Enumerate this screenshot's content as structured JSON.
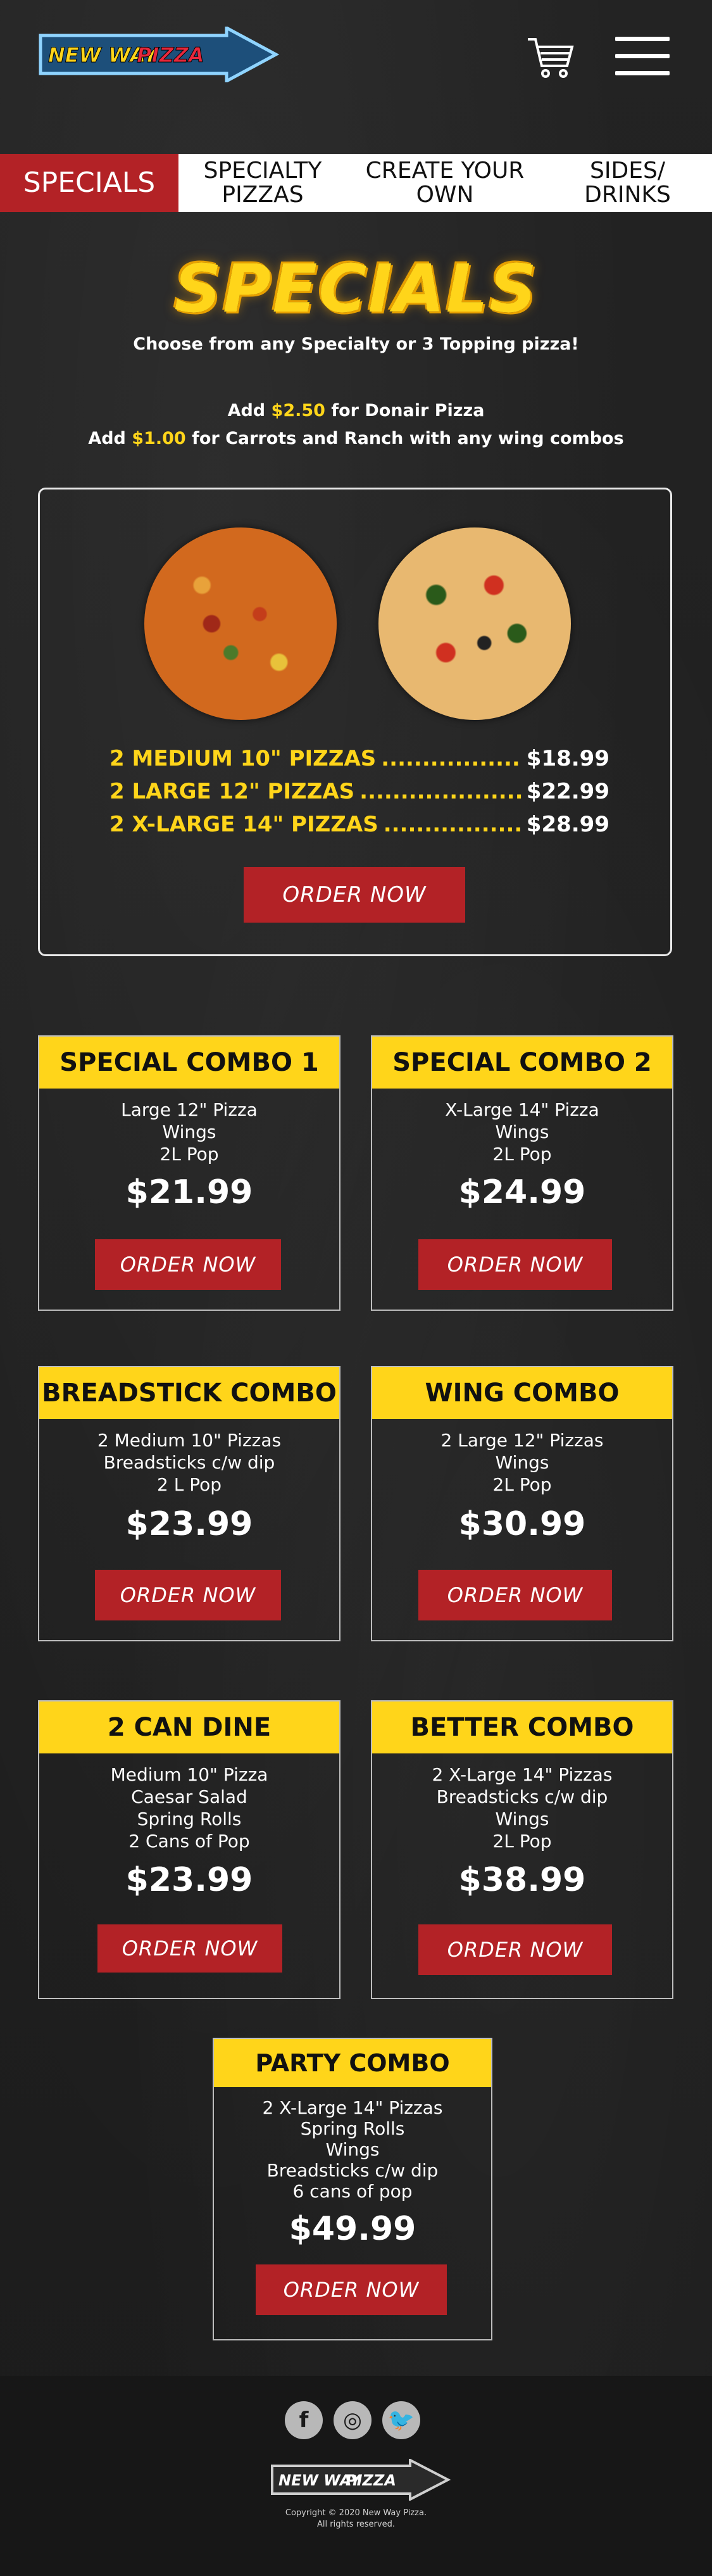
{
  "header": {
    "logo_text_new_way": "NEW WAY",
    "logo_text_pizza": "PIZZA",
    "cart_icon": "cart-icon",
    "menu_icon": "hamburger-menu-icon"
  },
  "nav": {
    "tabs": [
      {
        "label": "SPECIALS",
        "active": true
      },
      {
        "label": "SPECIALTY PIZZAS",
        "active": false
      },
      {
        "label": "CREATE YOUR OWN",
        "active": false
      },
      {
        "label": "SIDES/ DRINKS",
        "active": false
      }
    ]
  },
  "specials": {
    "title": "SPECIALS",
    "subtitle": "Choose from any Specialty or 3 Topping pizza!",
    "add1_pre": "Add ",
    "add1_price": "$2.50",
    "add1_post": " for Donair Pizza",
    "add2_pre": "Add ",
    "add2_price": "$1.00",
    "add2_post": " for Carrots and Ranch with any wing combos"
  },
  "main_offer": {
    "rows": [
      {
        "label": "2 MEDIUM 10\" PIZZAS",
        "price": "$18.99"
      },
      {
        "label": "2 LARGE 12\" PIZZAS",
        "price": "$22.99"
      },
      {
        "label": "2 X-LARGE 14\" PIZZAS",
        "price": "$28.99"
      }
    ],
    "button": "ORDER NOW"
  },
  "combos": [
    {
      "title": "SPECIAL COMBO 1",
      "items": [
        "Large 12\" Pizza",
        "Wings",
        "2L Pop"
      ],
      "price": "$21.99",
      "button": "ORDER NOW"
    },
    {
      "title": "SPECIAL COMBO 2",
      "items": [
        "X-Large 14\" Pizza",
        "Wings",
        "2L Pop"
      ],
      "price": "$24.99",
      "button": "ORDER NOW"
    },
    {
      "title": "BREADSTICK COMBO",
      "items": [
        "2 Medium 10\" Pizzas",
        "Breadsticks c/w dip",
        "2 L Pop"
      ],
      "price": "$23.99",
      "button": "ORDER NOW"
    },
    {
      "title": "WING COMBO",
      "items": [
        "2 Large 12\" Pizzas",
        "Wings",
        "2L Pop"
      ],
      "price": "$30.99",
      "button": "ORDER NOW"
    },
    {
      "title": "2 CAN DINE",
      "items": [
        "Medium 10\" Pizza",
        "Caesar Salad",
        "Spring Rolls",
        "2 Cans of Pop"
      ],
      "price": "$23.99",
      "button": "ORDER NOW"
    },
    {
      "title": "BETTER COMBO",
      "items": [
        "2 X-Large 14\" Pizzas",
        "Breadsticks c/w dip",
        "Wings",
        "2L Pop"
      ],
      "price": "$38.99",
      "button": "ORDER NOW"
    },
    {
      "title": "PARTY COMBO",
      "items": [
        "2 X-Large 14\" Pizzas",
        "Spring Rolls",
        "Wings",
        "Breadsticks c/w dip",
        "6 cans of pop"
      ],
      "price": "$49.99",
      "button": "ORDER NOW"
    }
  ],
  "footer": {
    "social": [
      {
        "icon": "facebook-icon",
        "glyph": "f"
      },
      {
        "icon": "instagram-icon",
        "glyph": "◎"
      },
      {
        "icon": "twitter-icon",
        "glyph": "🐦"
      }
    ],
    "logo_text_new_way": "NEW WAY",
    "logo_text_pizza": "PIZZA",
    "copyright_line1": "Copyright © 2020 New Way Pizza.",
    "copyright_line2": "All rights reserved."
  },
  "colors": {
    "accent_red": "#b32226",
    "accent_yellow": "#ffd51a",
    "background": "#1f1f1f"
  }
}
